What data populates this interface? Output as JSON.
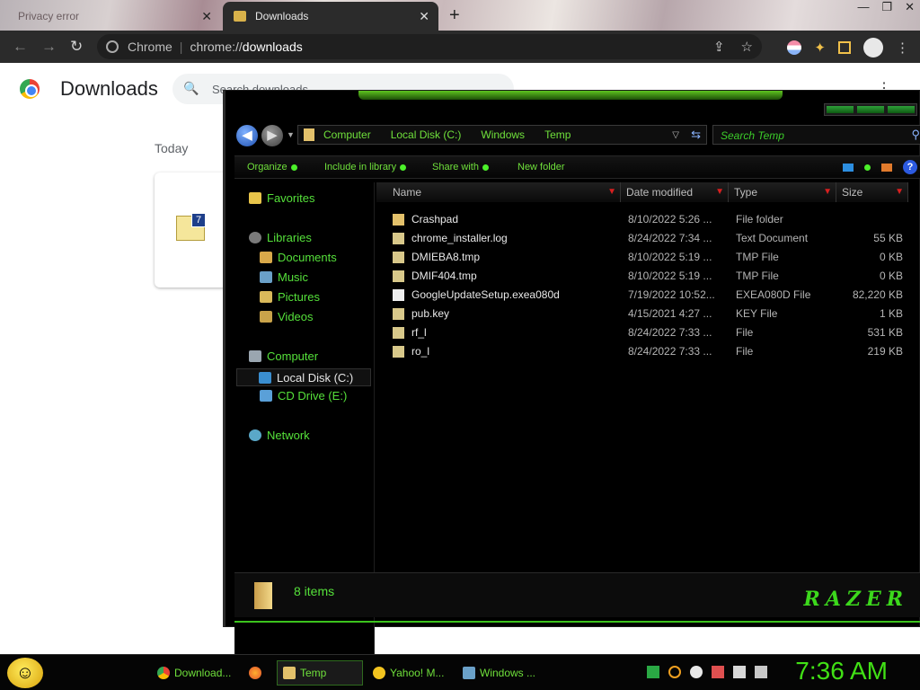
{
  "browser": {
    "tabs": [
      {
        "label": "Privacy error",
        "active": false
      },
      {
        "label": "Downloads",
        "active": true
      }
    ],
    "new_tab": "+",
    "close_glyph": "✕",
    "window_controls": [
      "—",
      "❐",
      "✕"
    ],
    "omnibox": {
      "site": "Chrome",
      "url_prefix": "chrome://",
      "url_host": "downloads"
    },
    "icons": [
      "back-icon",
      "forward-icon",
      "reload-icon",
      "share-icon",
      "bookmark-star-icon",
      "extension-puzzle-icon",
      "sidebar-icon",
      "profile-icon",
      "kebab-menu-icon"
    ]
  },
  "downloads_page": {
    "title": "Downloads",
    "search_placeholder": "Search downloads",
    "section_today": "Today",
    "menu_glyph": "⋮"
  },
  "explorer": {
    "breadcrumbs": [
      "Computer",
      "Local Disk (C:)",
      "Windows",
      "Temp"
    ],
    "search_placeholder": "Search Temp",
    "commands": [
      "Organize",
      "Include in library",
      "Share with",
      "New folder"
    ],
    "nav": {
      "favorites": "Favorites",
      "libraries": "Libraries",
      "library_items": [
        "Documents",
        "Music",
        "Pictures",
        "Videos"
      ],
      "computer": "Computer",
      "drives": [
        "Local Disk (C:)",
        "CD Drive (E:)"
      ],
      "network": "Network",
      "selected": "Local Disk (C:)"
    },
    "columns": {
      "name": "Name",
      "date": "Date modified",
      "type": "Type",
      "size": "Size"
    },
    "files": [
      {
        "name": "Crashpad",
        "date": "8/10/2022 5:26 ...",
        "type": "File folder",
        "size": ""
      },
      {
        "name": "chrome_installer.log",
        "date": "8/24/2022 7:34 ...",
        "type": "Text Document",
        "size": "55 KB"
      },
      {
        "name": "DMIEBA8.tmp",
        "date": "8/10/2022 5:19 ...",
        "type": "TMP File",
        "size": "0 KB"
      },
      {
        "name": "DMIF404.tmp",
        "date": "8/10/2022 5:19 ...",
        "type": "TMP File",
        "size": "0 KB"
      },
      {
        "name": "GoogleUpdateSetup.exea080d",
        "date": "7/19/2022 10:52...",
        "type": "EXEA080D File",
        "size": "82,220 KB"
      },
      {
        "name": "pub.key",
        "date": "4/15/2021 4:27 ...",
        "type": "KEY File",
        "size": "1 KB"
      },
      {
        "name": "rf_l",
        "date": "8/24/2022 7:33 ...",
        "type": "File",
        "size": "531 KB"
      },
      {
        "name": "ro_l",
        "date": "8/24/2022 7:33 ...",
        "type": "File",
        "size": "219 KB"
      }
    ],
    "status_count": "8 items",
    "brand": "RAZER"
  },
  "taskbar": {
    "items": [
      {
        "label": "Download...",
        "icon": "chrome-icon",
        "active": false
      },
      {
        "label": "",
        "icon": "firefox-icon",
        "active": false
      },
      {
        "label": "Temp",
        "icon": "folder-icon",
        "active": true
      },
      {
        "label": "Yahoo! M...",
        "icon": "yahoo-messenger-icon",
        "active": false
      },
      {
        "label": "Windows ...",
        "icon": "windows-app-icon",
        "active": false
      }
    ],
    "clock": "7:36 AM"
  },
  "colors": {
    "accent_green": "#41e015",
    "explorer_bg": "#000000",
    "chrome_dark": "#2b2b2b"
  }
}
